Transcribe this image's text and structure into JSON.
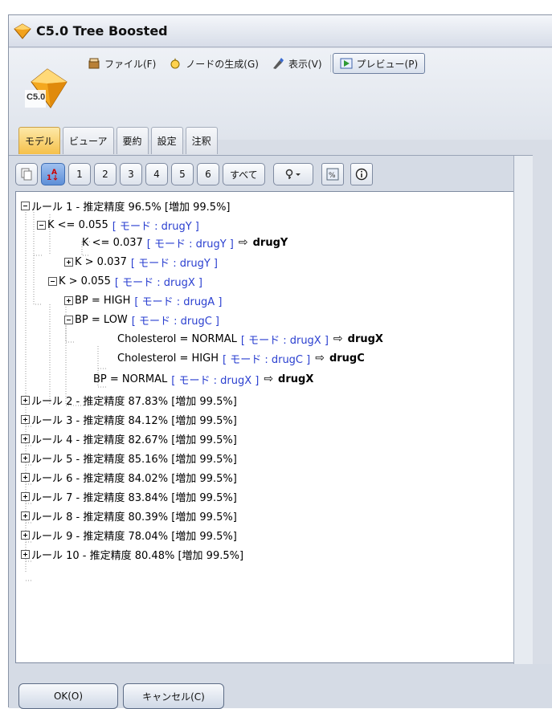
{
  "window": {
    "title": "C5.0 Tree Boosted"
  },
  "menu": [
    {
      "label": "ファイル(F)",
      "icon": "file-icon"
    },
    {
      "label": "ノードの生成(G)",
      "icon": "generate-icon"
    },
    {
      "label": "表示(V)",
      "icon": "view-icon"
    },
    {
      "label": "プレビュー(P)",
      "icon": "preview-icon"
    }
  ],
  "model_label": "C5.0",
  "tabs": [
    "モデル",
    "ビューア",
    "要約",
    "設定",
    "注釈"
  ],
  "toolbar": {
    "numbers": [
      "1",
      "2",
      "3",
      "4",
      "5",
      "6"
    ],
    "all_label": "すべて"
  },
  "tree": {
    "rule1": "ルール 1 - 推定精度 96.5% [増加 99.5%]",
    "k_le_0055": "K <= 0.055",
    "k_le_0055_mode": "[ モード : drugY ]",
    "k_le_0037": "K <= 0.037",
    "k_le_0037_mode": "[ モード : drugY ]",
    "k_le_0037_result": "drugY",
    "k_gt_0037": "K > 0.037",
    "k_gt_0037_mode": "[ モード : drugY ]",
    "k_gt_0055": "K > 0.055",
    "k_gt_0055_mode": "[ モード : drugX ]",
    "bp_high": "BP = HIGH",
    "bp_high_mode": "[ モード : drugA ]",
    "bp_low": "BP = LOW",
    "bp_low_mode": "[ モード : drugC ]",
    "chol_normal": "Cholesterol = NORMAL",
    "chol_normal_mode": "[ モード : drugX ]",
    "chol_normal_result": "drugX",
    "chol_high": "Cholesterol = HIGH",
    "chol_high_mode": "[ モード : drugC ]",
    "chol_high_result": "drugC",
    "bp_normal": "BP = NORMAL",
    "bp_normal_mode": "[ モード : drugX ]",
    "bp_normal_result": "drugX",
    "rules": [
      "ルール 2 - 推定精度 87.83% [増加 99.5%]",
      "ルール 3 - 推定精度 84.12% [増加 99.5%]",
      "ルール 4 - 推定精度 82.67% [増加 99.5%]",
      "ルール 5 - 推定精度 85.16% [増加 99.5%]",
      "ルール 6 - 推定精度 84.02% [増加 99.5%]",
      "ルール 7 - 推定精度 83.84% [増加 99.5%]",
      "ルール 8 - 推定精度 80.39% [増加 99.5%]",
      "ルール 9 - 推定精度 78.04% [増加 99.5%]",
      "ルール 10 - 推定精度 80.48% [増加 99.5%]"
    ]
  },
  "buttons": {
    "ok": "OK(O)",
    "cancel": "キャンセル(C)"
  },
  "colors": {
    "mode_text": "#2a3fd0",
    "active_tab": "#f5c04a"
  }
}
